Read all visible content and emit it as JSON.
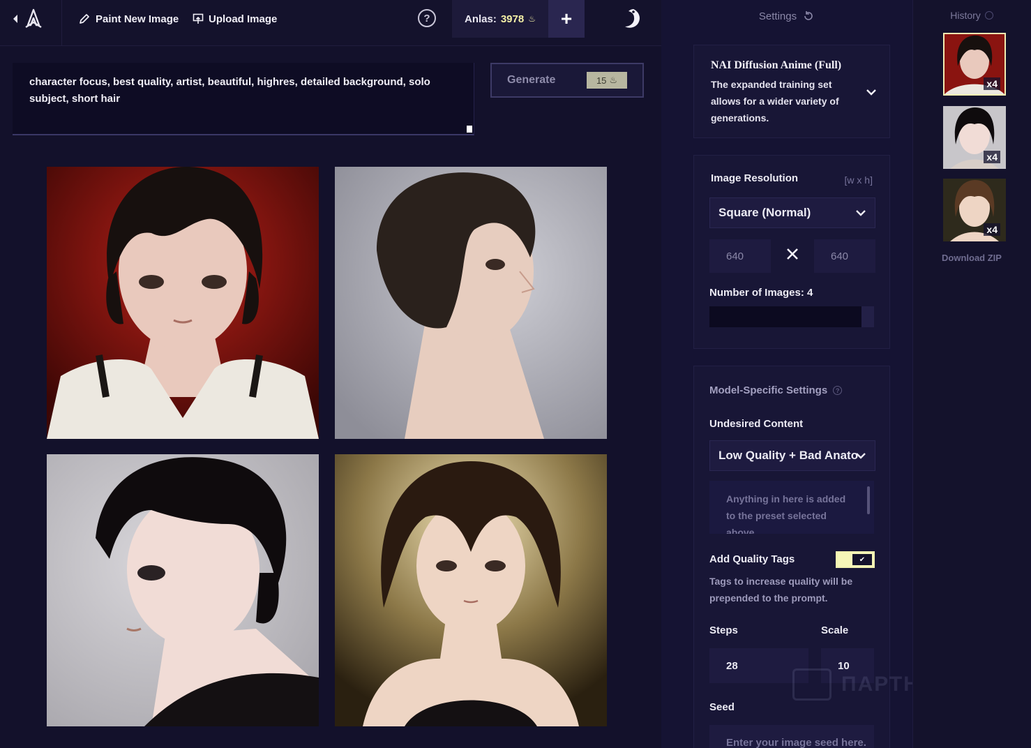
{
  "topbar": {
    "paint_label": "Paint New Image",
    "upload_label": "Upload Image",
    "help": "?",
    "anlas_label": "Anlas:",
    "anlas_value": "3978",
    "plus": "+"
  },
  "prompt": {
    "text": "character focus, best quality, artist, beautiful, highres, detailed background, solo subject, short hair"
  },
  "generate": {
    "label": "Generate",
    "cost": "15"
  },
  "images": [
    {
      "background": "#8a1410",
      "bg_dark": "#3d0705",
      "hair": "#17100e",
      "skin": "#e9c9bd",
      "outfit": "#ece8e0"
    },
    {
      "background": "#b8b8c0",
      "bg_dark": "#8e8e98",
      "hair": "#2a211c",
      "skin": "#e7cdbf",
      "outfit": "#d9c9c0"
    },
    {
      "background": "#c8c6ca",
      "bg_dark": "#a6a4aa",
      "hair": "#0f0b0d",
      "skin": "#f1dcd6",
      "outfit": "#141012"
    },
    {
      "background": "#e8d7a8",
      "bg_dark": "#3a2e14",
      "hair": "#2a1a10",
      "skin": "#eed5c4",
      "outfit": "#141012"
    }
  ],
  "settings": {
    "title": "Settings",
    "model_name": "NAI Diffusion Anime (Full)",
    "model_desc": "The expanded training set allows for a wider variety of generations.",
    "resolution_label": "Image Resolution",
    "resolution_hint": "[w x h]",
    "resolution_value": "Square (Normal)",
    "width": "640",
    "height": "640",
    "num_images_label": "Number of Images:",
    "num_images_value": "4",
    "model_specific_label": "Model-Specific Settings",
    "undesired_label": "Undesired Content",
    "undesired_value": "Low Quality + Bad Anato",
    "undesired_placeholder": "Anything in here is added to the preset selected above.",
    "quality_tags_label": "Add Quality Tags",
    "quality_tags_desc": "Tags to increase quality will be prepended to the prompt.",
    "quality_tags_on": true,
    "steps_label": "Steps",
    "steps_value": "28",
    "scale_label": "Scale",
    "scale_value": "10",
    "seed_label": "Seed",
    "seed_placeholder": "Enter your image seed here."
  },
  "history": {
    "title": "History",
    "badge": "x4",
    "download": "Download ZIP",
    "thumbs": [
      {
        "background": "#8a1410",
        "hair": "#17100e",
        "skin": "#e9c9bd",
        "selected": true
      },
      {
        "background": "#c8c6ca",
        "hair": "#0f0b0d",
        "skin": "#f1dcd6",
        "selected": false
      },
      {
        "background": "#2e2a1c",
        "hair": "#5a3a24",
        "skin": "#eed5c4",
        "selected": false
      }
    ]
  },
  "watermark": "ПАРТНЕРКИН",
  "colors": {
    "accent": "#f4f0a6",
    "background": "#13112b",
    "panel": "#181636"
  }
}
